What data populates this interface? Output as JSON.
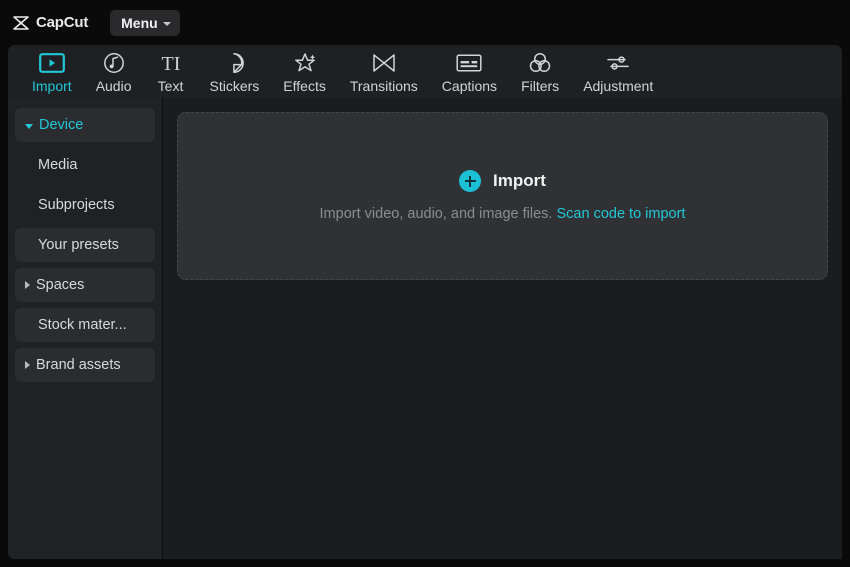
{
  "titlebar": {
    "brand_name": "CapCut",
    "brand_icon": "capcut-logo-icon",
    "menu_label": "Menu",
    "menu_caret_icon": "chevron-down-icon"
  },
  "toolbar": {
    "active": "Import",
    "accent_color": "#22c8d8",
    "tabs": [
      {
        "label": "Import",
        "icon": "import-play-frame-icon"
      },
      {
        "label": "Audio",
        "icon": "music-note-circle-icon"
      },
      {
        "label": "Text",
        "icon": "text-ti-icon"
      },
      {
        "label": "Stickers",
        "icon": "sticker-peel-icon"
      },
      {
        "label": "Effects",
        "icon": "sparkle-star-icon"
      },
      {
        "label": "Transitions",
        "icon": "transition-bowtie-icon"
      },
      {
        "label": "Captions",
        "icon": "captions-box-icon"
      },
      {
        "label": "Filters",
        "icon": "filters-three-circles-icon"
      },
      {
        "label": "Adjustment",
        "icon": "sliders-icon"
      }
    ]
  },
  "sidebar": {
    "items": [
      {
        "label": "Device",
        "caret": "down",
        "style": "active",
        "icon": "caret-down-icon"
      },
      {
        "label": "Media",
        "caret": "none",
        "style": "sub",
        "icon": ""
      },
      {
        "label": "Subprojects",
        "caret": "none",
        "style": "sub",
        "icon": ""
      },
      {
        "label": "Your presets",
        "caret": "none",
        "style": "boxed",
        "icon": ""
      },
      {
        "label": "Spaces",
        "caret": "right",
        "style": "boxed",
        "icon": "caret-right-icon"
      },
      {
        "label": "Stock mater...",
        "caret": "none",
        "style": "boxed",
        "icon": ""
      },
      {
        "label": "Brand assets",
        "caret": "right",
        "style": "boxed",
        "icon": "caret-right-icon"
      }
    ]
  },
  "main": {
    "dropzone": {
      "plus_icon": "plus-circle-icon",
      "title": "Import",
      "subtitle": "Import video, audio, and image files.",
      "link_text": "Scan code to import"
    }
  }
}
